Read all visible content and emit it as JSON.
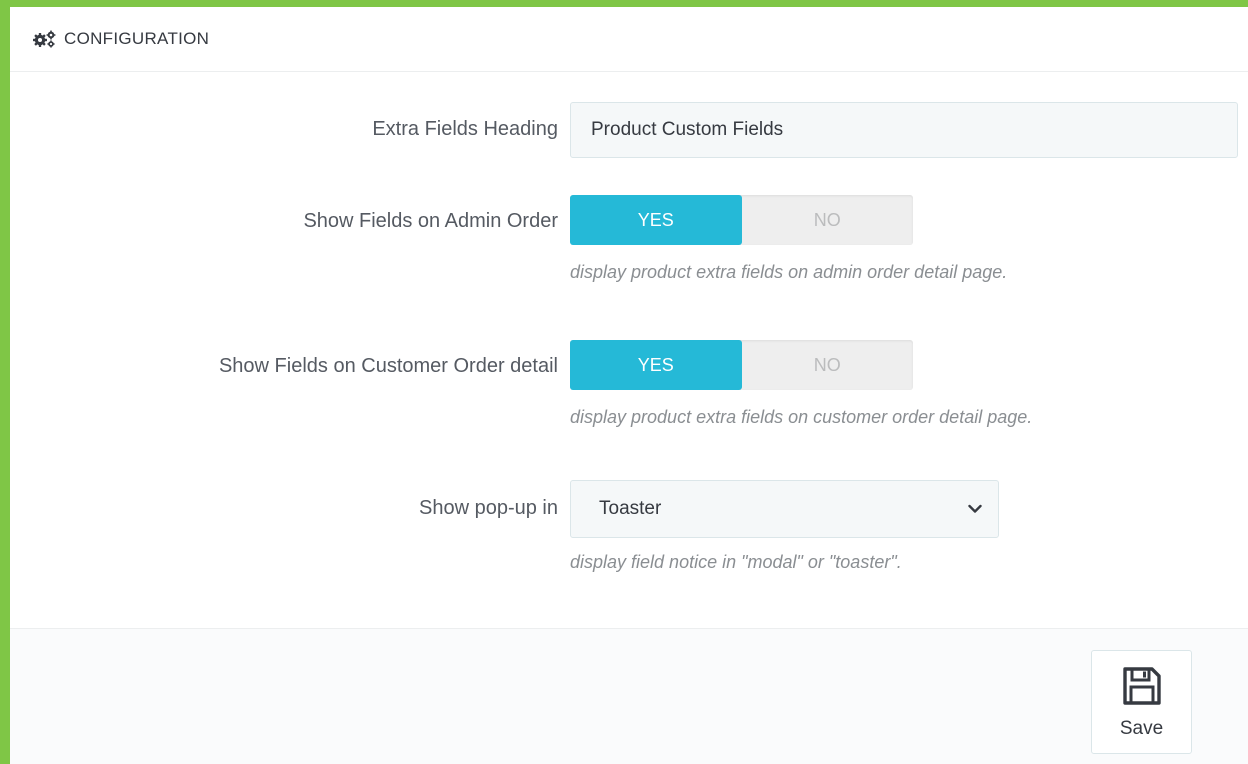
{
  "panel": {
    "title": "CONFIGURATION",
    "icon": "cogs-icon"
  },
  "fields": {
    "extra_heading": {
      "label": "Extra Fields Heading",
      "value": "Product Custom Fields"
    },
    "admin_order": {
      "label": "Show Fields on Admin Order",
      "yes": "YES",
      "no": "NO",
      "selected": "YES",
      "help": "display product extra fields on admin order detail page."
    },
    "customer_order": {
      "label": "Show Fields on Customer Order detail",
      "yes": "YES",
      "no": "NO",
      "selected": "YES",
      "help": "display product extra fields on customer order detail page."
    },
    "popup": {
      "label": "Show pop-up in",
      "selected": "Toaster",
      "help": "display field notice in \"modal\" or \"toaster\"."
    }
  },
  "footer": {
    "save_label": "Save",
    "save_icon": "floppy-disk-icon"
  },
  "colors": {
    "border_accent": "#7fc646",
    "switch_active": "#25b9d7"
  }
}
